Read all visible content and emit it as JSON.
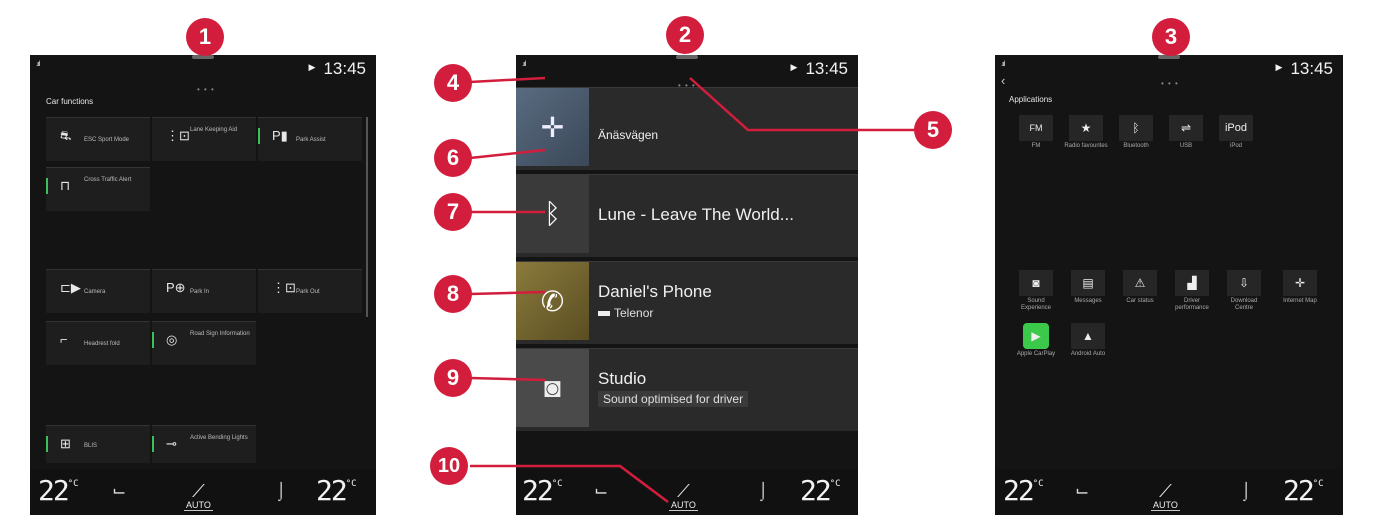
{
  "markers": [
    "1",
    "2",
    "3",
    "4",
    "5",
    "6",
    "7",
    "8",
    "9",
    "10"
  ],
  "colors": {
    "marker": "#d21e3c",
    "accent_bar": "#3fbf5a",
    "screen_bg": "#141414"
  },
  "status": {
    "time": "13:45",
    "signal": ".ııl",
    "nav_flag": "▶"
  },
  "climate": {
    "temp_left": "22",
    "temp_right": "22",
    "unit": "°C",
    "fan_mode": "AUTO"
  },
  "screen1": {
    "title": "Car functions",
    "dots": "• • •",
    "tiles": [
      {
        "icon": "esc-icon",
        "glyph": "⛐",
        "label": "ESC Sport Mode",
        "bar": false
      },
      {
        "icon": "lane-keeping-icon",
        "glyph": "⋮⊡",
        "label": "Lane Keeping Aid",
        "bar": false
      },
      {
        "icon": "park-assist-icon",
        "glyph": "P▮",
        "label": "Park Assist",
        "bar": true
      },
      {
        "icon": "cross-traffic-icon",
        "glyph": "⊓",
        "label": "Cross Traffic Alert",
        "bar": true
      },
      {
        "icon": "camera-icon",
        "glyph": "⊏▶",
        "label": "Camera",
        "bar": false
      },
      {
        "icon": "park-in-icon",
        "glyph": "P⊕",
        "label": "Park In",
        "bar": false
      },
      {
        "icon": "park-out-icon",
        "glyph": "⋮⊡",
        "label": "Park Out",
        "bar": false
      },
      {
        "icon": "headrest-icon",
        "glyph": "⌐",
        "label": "Headrest fold",
        "bar": false
      },
      {
        "icon": "road-sign-icon",
        "glyph": "◎",
        "label": "Road Sign Information",
        "bar": true
      },
      {
        "icon": "blis-icon",
        "glyph": "⊞",
        "label": "BLIS",
        "bar": true
      },
      {
        "icon": "bending-lights-icon",
        "glyph": "⊸",
        "label": "Active Bending Lights",
        "bar": true
      }
    ]
  },
  "screen2": {
    "dots": "• • •",
    "cards": [
      {
        "icon": "navigation-compass-icon",
        "glyph": "✛",
        "title": "Änäsvägen",
        "subtitle": ""
      },
      {
        "icon": "bluetooth-icon",
        "glyph": "ᛒ",
        "title": "Lune - Leave The World...",
        "subtitle": ""
      },
      {
        "icon": "phone-icon",
        "glyph": "✆",
        "title": "Daniel's Phone",
        "subtitle": "Telenor"
      },
      {
        "icon": "speaker-icon",
        "glyph": "◙",
        "title": "Studio",
        "subtitle": "Sound optimised for driver"
      }
    ]
  },
  "screen3": {
    "title": "Applications",
    "back": "‹",
    "dots": "• • •",
    "apps_top": [
      {
        "icon": "fm-radio-icon",
        "glyph": "FM",
        "label": "FM"
      },
      {
        "icon": "radio-favourites-icon",
        "glyph": "★",
        "label": "Radio favourites"
      },
      {
        "icon": "bluetooth-app-icon",
        "glyph": "ᛒ",
        "label": "Bluetooth"
      },
      {
        "icon": "usb-icon",
        "glyph": "⇌",
        "label": "USB"
      },
      {
        "icon": "ipod-icon",
        "glyph": "iPod",
        "label": "iPod"
      }
    ],
    "apps_bottom": [
      {
        "icon": "sound-experience-icon",
        "glyph": "◙",
        "label": "Sound Experience"
      },
      {
        "icon": "messages-icon",
        "glyph": "▤",
        "label": "Messages"
      },
      {
        "icon": "car-status-icon",
        "glyph": "⚠",
        "label": "Car status"
      },
      {
        "icon": "driver-performance-icon",
        "glyph": "▟",
        "label": "Driver performance"
      },
      {
        "icon": "download-centre-icon",
        "glyph": "⇩",
        "label": "Download Centre"
      },
      {
        "icon": "internet-map-icon",
        "glyph": "✛",
        "label": "Internet Map"
      },
      {
        "icon": "apple-carplay-icon",
        "glyph": "▶",
        "label": "Apple CarPlay"
      },
      {
        "icon": "android-auto-icon",
        "glyph": "▲",
        "label": "Android Auto"
      }
    ]
  }
}
